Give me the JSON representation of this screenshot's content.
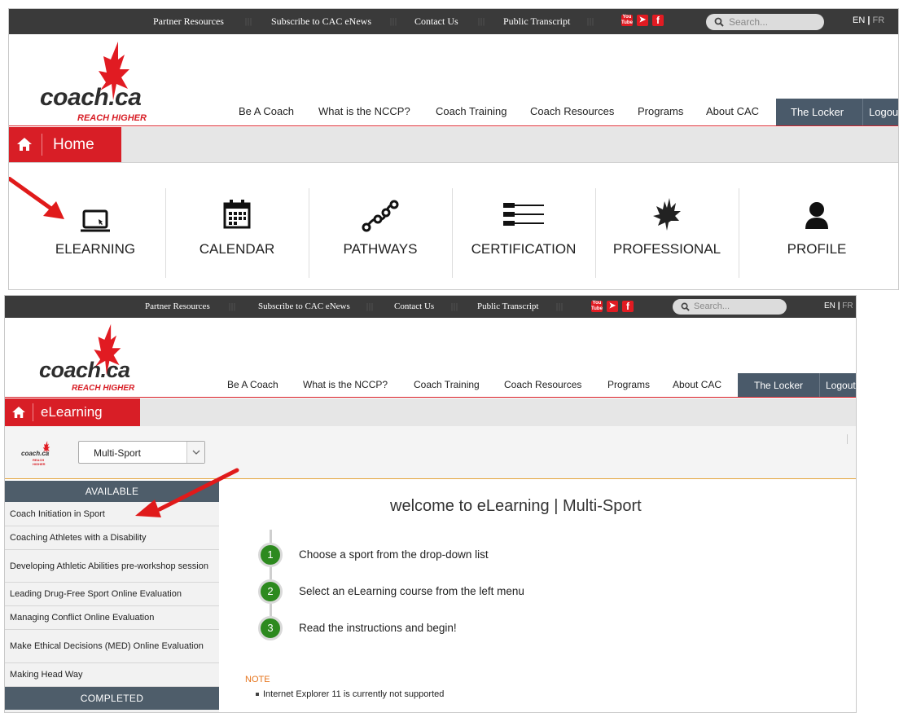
{
  "topbar": {
    "links": [
      "Partner Resources",
      "Subscribe to CAC eNews",
      "Contact Us",
      "Public Transcript"
    ],
    "separator": "|||",
    "social": [
      "YouTube",
      "Twitter",
      "Facebook"
    ],
    "search_placeholder": "Search...",
    "lang_en": "EN",
    "lang_sep": "|",
    "lang_fr": "FR"
  },
  "logo": {
    "word": "coach.ca",
    "tagline": "REACH HIGHER"
  },
  "nav": {
    "items": [
      "Be A Coach",
      "What is the NCCP?",
      "Coach Training",
      "Coach Resources",
      "Programs",
      "About CAC"
    ],
    "locker": "The Locker",
    "logout": "Logout"
  },
  "screen1": {
    "crumb": "Home",
    "tiles": [
      "ELEARNING",
      "CALENDAR",
      "PATHWAYS",
      "CERTIFICATION",
      "PROFESSIONAL",
      "PROFILE"
    ]
  },
  "screen2": {
    "crumb": "eLearning",
    "mini_logo": "coach.ca",
    "mini_tagline": "REACH HIGHER",
    "sport_select": "Multi-Sport",
    "sidebar": {
      "available_header": "AVAILABLE",
      "items": [
        "Coach Initiation in Sport",
        "Coaching Athletes with a Disability",
        "Developing Athletic Abilities pre-workshop session",
        "Leading Drug-Free Sport Online Evaluation",
        "Managing Conflict Online Evaluation",
        "Make Ethical Decisions (MED) Online Evaluation",
        "Making Head Way"
      ],
      "completed_header": "COMPLETED"
    },
    "welcome": "welcome to eLearning | Multi-Sport",
    "steps": [
      {
        "num": "1",
        "text": "Choose a sport from the drop-down list"
      },
      {
        "num": "2",
        "text": "Select an eLearning course from the left menu"
      },
      {
        "num": "3",
        "text": "Read the instructions and begin!"
      }
    ],
    "note_label": "NOTE",
    "note_items": [
      "Internet Explorer 11 is currently not supported"
    ]
  },
  "colors": {
    "brand_red": "#d81e26",
    "topbar": "#3a3a3a",
    "locker": "#4a5a6a",
    "step_green": "#2d8a1f",
    "note_orange": "#e6731a"
  }
}
